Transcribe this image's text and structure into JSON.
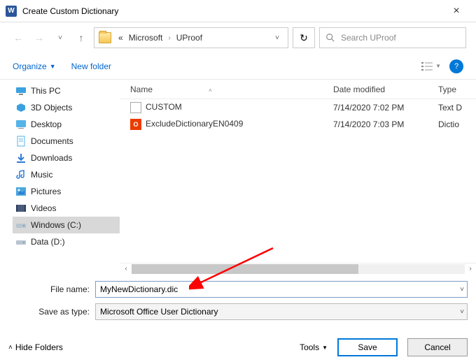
{
  "title": "Create Custom Dictionary",
  "breadcrumb": {
    "prefix": "«",
    "seg1": "Microsoft",
    "seg2": "UProof"
  },
  "search": {
    "placeholder": "Search UProof"
  },
  "toolbar": {
    "organize": "Organize",
    "newfolder": "New folder"
  },
  "tree": {
    "items": [
      {
        "label": "This PC",
        "icon": "pc"
      },
      {
        "label": "3D Objects",
        "icon": "3d"
      },
      {
        "label": "Desktop",
        "icon": "desktop"
      },
      {
        "label": "Documents",
        "icon": "doc"
      },
      {
        "label": "Downloads",
        "icon": "down"
      },
      {
        "label": "Music",
        "icon": "music"
      },
      {
        "label": "Pictures",
        "icon": "pic"
      },
      {
        "label": "Videos",
        "icon": "vid"
      },
      {
        "label": "Windows (C:)",
        "icon": "drive",
        "selected": true
      },
      {
        "label": "Data (D:)",
        "icon": "drive"
      }
    ]
  },
  "columns": {
    "name": "Name",
    "date": "Date modified",
    "type": "Type"
  },
  "files": [
    {
      "name": "CUSTOM",
      "date": "7/14/2020 7:02 PM",
      "type": "Text D",
      "icon": "txt"
    },
    {
      "name": "ExcludeDictionaryEN0409",
      "date": "7/14/2020 7:03 PM",
      "type": "Dictio",
      "icon": "office"
    }
  ],
  "fields": {
    "filename_label": "File name:",
    "filename_value": "MyNewDictionary.dic",
    "saveas_label": "Save as type:",
    "saveas_value": "Microsoft Office User Dictionary"
  },
  "footer": {
    "hide": "Hide Folders",
    "tools": "Tools",
    "save": "Save",
    "cancel": "Cancel"
  }
}
